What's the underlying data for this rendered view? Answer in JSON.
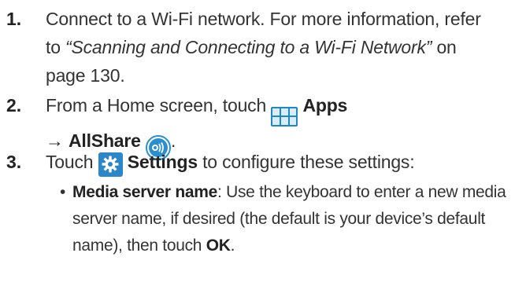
{
  "steps": [
    {
      "number": "1.",
      "text_a": "Connect to a Wi-Fi network. For more information, refer",
      "text_b": "to ",
      "link_ref": "“Scanning and Connecting to a Wi-Fi Network”",
      "text_c": " on",
      "text_d": "page 130."
    },
    {
      "number": "2.",
      "text_a": "From a Home screen, touch ",
      "apps_label": "Apps",
      "arrow": "→",
      "allshare_label": "AllShare",
      "end": "."
    },
    {
      "number": "3.",
      "text_a": "Touch ",
      "settings_label": "Settings",
      "text_b": " to configure these settings:"
    }
  ],
  "bullets": [
    {
      "dot": "•",
      "term": "Media server name",
      "text_a": ": Use the keyboard to enter a new media",
      "text_b": "server name, if desired (the default is your device’s default",
      "text_c": "name), then touch ",
      "ok": "OK",
      "end": "."
    }
  ],
  "icons": {
    "apps": "apps-grid-icon",
    "allshare": "allshare-icon",
    "settings": "gear-icon"
  },
  "colors": {
    "icon_blue": "#1f86c8"
  }
}
